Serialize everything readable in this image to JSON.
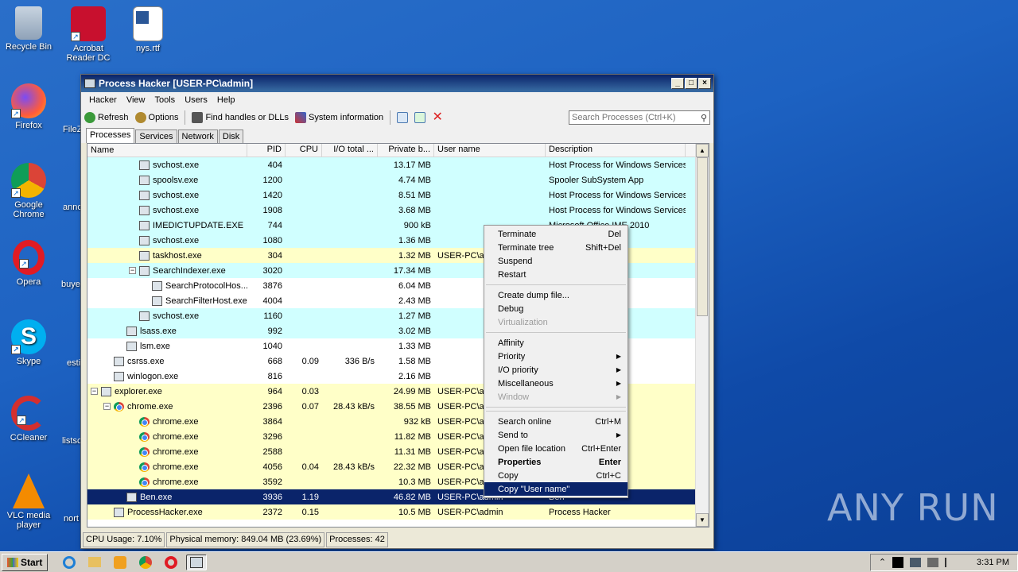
{
  "desktop": {
    "icons": [
      {
        "label": "Recycle Bin"
      },
      {
        "label": "Acrobat Reader DC"
      },
      {
        "label": "nys.rtf"
      },
      {
        "label": "Firefox"
      },
      {
        "label": "Google Chrome"
      },
      {
        "label": "Opera"
      },
      {
        "label": "Skype"
      },
      {
        "label": "CCleaner"
      },
      {
        "label": "VLC media player"
      }
    ],
    "partial_labels": [
      "FileZ",
      "anno",
      "buye",
      "esti",
      "listsc",
      "nort"
    ],
    "watermark": "ANY RUN"
  },
  "window": {
    "title": "Process Hacker [USER-PC\\admin]",
    "menu": [
      "Hacker",
      "View",
      "Tools",
      "Users",
      "Help"
    ],
    "toolbar": {
      "refresh": "Refresh",
      "options": "Options",
      "find_handles": "Find handles or DLLs",
      "system_info": "System information"
    },
    "search_placeholder": "Search Processes (Ctrl+K)",
    "tabs": [
      "Processes",
      "Services",
      "Network",
      "Disk"
    ],
    "columns": [
      "Name",
      "PID",
      "CPU",
      "I/O total ...",
      "Private b...",
      "User name",
      "Description"
    ],
    "rows": [
      {
        "name": "svchost.exe",
        "pid": "404",
        "cpu": "",
        "io": "",
        "priv": "13.17 MB",
        "user": "",
        "desc": "Host Process for Windows Services"
      },
      {
        "name": "spoolsv.exe",
        "pid": "1200",
        "cpu": "",
        "io": "",
        "priv": "4.74 MB",
        "user": "",
        "desc": "Spooler SubSystem App"
      },
      {
        "name": "svchost.exe",
        "pid": "1420",
        "cpu": "",
        "io": "",
        "priv": "8.51 MB",
        "user": "",
        "desc": "Host Process for Windows Services"
      },
      {
        "name": "svchost.exe",
        "pid": "1908",
        "cpu": "",
        "io": "",
        "priv": "3.68 MB",
        "user": "",
        "desc": "Host Process for Windows Services"
      },
      {
        "name": "IMEDICTUPDATE.EXE",
        "pid": "744",
        "cpu": "",
        "io": "",
        "priv": "900 kB",
        "user": "",
        "desc": "Microsoft Office IME 2010"
      },
      {
        "name": "svchost.exe",
        "pid": "1080",
        "cpu": "",
        "io": "",
        "priv": "1.36 MB",
        "user": "",
        "desc": "dows Services"
      },
      {
        "name": "taskhost.exe",
        "pid": "304",
        "cpu": "",
        "io": "",
        "priv": "1.32 MB",
        "user": "USER-PC\\ad",
        "desc": "dows Tasks"
      },
      {
        "name": "SearchIndexer.exe",
        "pid": "3020",
        "cpu": "",
        "io": "",
        "priv": "17.34 MB",
        "user": "",
        "desc": "earch Indexer"
      },
      {
        "name": "SearchProtocolHos...",
        "pid": "3876",
        "cpu": "",
        "io": "",
        "priv": "6.04 MB",
        "user": "",
        "desc": "earch Proto..."
      },
      {
        "name": "SearchFilterHost.exe",
        "pid": "4004",
        "cpu": "",
        "io": "",
        "priv": "2.43 MB",
        "user": "",
        "desc": "earch Filter ..."
      },
      {
        "name": "svchost.exe",
        "pid": "1160",
        "cpu": "",
        "io": "",
        "priv": "1.27 MB",
        "user": "",
        "desc": "dows Services"
      },
      {
        "name": "lsass.exe",
        "pid": "992",
        "cpu": "",
        "io": "",
        "priv": "3.02 MB",
        "user": "",
        "desc": "rity Process"
      },
      {
        "name": "lsm.exe",
        "pid": "1040",
        "cpu": "",
        "io": "",
        "priv": "1.33 MB",
        "user": "",
        "desc": "er Service"
      },
      {
        "name": "csrss.exe",
        "pid": "668",
        "cpu": "0.09",
        "io": "336 B/s",
        "priv": "1.58 MB",
        "user": "",
        "desc": "e Process"
      },
      {
        "name": "winlogon.exe",
        "pid": "816",
        "cpu": "",
        "io": "",
        "priv": "2.16 MB",
        "user": "",
        "desc": "cation"
      },
      {
        "name": "explorer.exe",
        "pid": "964",
        "cpu": "0.03",
        "io": "",
        "priv": "24.99 MB",
        "user": "USER-PC\\ad",
        "desc": ""
      },
      {
        "name": "chrome.exe",
        "pid": "2396",
        "cpu": "0.07",
        "io": "28.43 kB/s",
        "priv": "38.55 MB",
        "user": "USER-PC\\ad",
        "desc": ""
      },
      {
        "name": "chrome.exe",
        "pid": "3864",
        "cpu": "",
        "io": "",
        "priv": "932 kB",
        "user": "USER-PC\\ad",
        "desc": ""
      },
      {
        "name": "chrome.exe",
        "pid": "3296",
        "cpu": "",
        "io": "",
        "priv": "11.82 MB",
        "user": "USER-PC\\ad",
        "desc": ""
      },
      {
        "name": "chrome.exe",
        "pid": "2588",
        "cpu": "",
        "io": "",
        "priv": "11.31 MB",
        "user": "USER-PC\\ad",
        "desc": ""
      },
      {
        "name": "chrome.exe",
        "pid": "4056",
        "cpu": "0.04",
        "io": "28.43 kB/s",
        "priv": "22.32 MB",
        "user": "USER-PC\\ad",
        "desc": ""
      },
      {
        "name": "chrome.exe",
        "pid": "3592",
        "cpu": "",
        "io": "",
        "priv": "10.3 MB",
        "user": "USER-PC\\ad",
        "desc": ""
      },
      {
        "name": "Ben.exe",
        "pid": "3936",
        "cpu": "1.19",
        "io": "",
        "priv": "46.82 MB",
        "user": "USER-PC\\admin",
        "desc": "Ben"
      },
      {
        "name": "ProcessHacker.exe",
        "pid": "2372",
        "cpu": "0.15",
        "io": "",
        "priv": "10.5 MB",
        "user": "USER-PC\\admin",
        "desc": "Process Hacker"
      }
    ],
    "status": {
      "cpu": "CPU Usage: 7.10%",
      "memory": "Physical memory: 849.04 MB (23.69%)",
      "processes": "Processes: 42"
    }
  },
  "context_menu": {
    "items": [
      {
        "label": "Terminate",
        "shortcut": "Del"
      },
      {
        "label": "Terminate tree",
        "shortcut": "Shift+Del"
      },
      {
        "label": "Suspend",
        "shortcut": ""
      },
      {
        "label": "Restart",
        "shortcut": ""
      },
      {
        "label": "Create dump file...",
        "shortcut": ""
      },
      {
        "label": "Debug",
        "shortcut": ""
      },
      {
        "label": "Virtualization",
        "shortcut": ""
      },
      {
        "label": "Affinity",
        "shortcut": ""
      },
      {
        "label": "Priority",
        "shortcut": ""
      },
      {
        "label": "I/O priority",
        "shortcut": ""
      },
      {
        "label": "Miscellaneous",
        "shortcut": ""
      },
      {
        "label": "Window",
        "shortcut": ""
      },
      {
        "label": "Search online",
        "shortcut": "Ctrl+M"
      },
      {
        "label": "Send to",
        "shortcut": ""
      },
      {
        "label": "Open file location",
        "shortcut": "Ctrl+Enter"
      },
      {
        "label": "Properties",
        "shortcut": "Enter"
      },
      {
        "label": "Copy",
        "shortcut": "Ctrl+C"
      },
      {
        "label": "Copy \"User name\"",
        "shortcut": ""
      }
    ]
  },
  "taskbar": {
    "start": "Start",
    "clock": "3:31 PM"
  },
  "colors": {
    "service_row": "#d0ffff",
    "user_row": "#ffffc8",
    "selected_row": "#0a246a"
  }
}
